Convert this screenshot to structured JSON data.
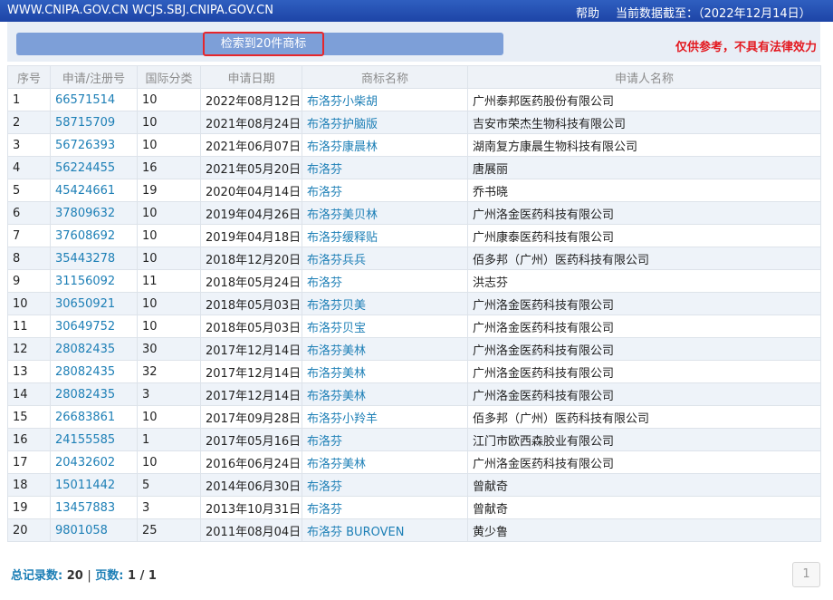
{
  "header": {
    "site": "WWW.CNIPA.GOV.CN WCJS.SBJ.CNIPA.GOV.CN",
    "help": "帮助",
    "data_as_of": "当前数据截至：（2022年12月14日）"
  },
  "search": {
    "result_label": "检索到20件商标",
    "disclaimer": "仅供参考，不具有法律效力"
  },
  "columns": [
    "序号",
    "申请/注册号",
    "国际分类",
    "申请日期",
    "商标名称",
    "申请人名称"
  ],
  "rows": [
    {
      "no": "1",
      "reg": "66571514",
      "cls": "10",
      "date": "2022年08月12日",
      "mark": "布洛芬小柴胡",
      "applicant": "广州泰邦医药股份有限公司"
    },
    {
      "no": "2",
      "reg": "58715709",
      "cls": "10",
      "date": "2021年08月24日",
      "mark": "布洛芬护脑版",
      "applicant": "吉安市荣杰生物科技有限公司"
    },
    {
      "no": "3",
      "reg": "56726393",
      "cls": "10",
      "date": "2021年06月07日",
      "mark": "布洛芬康晨林",
      "applicant": "湖南复方康晨生物科技有限公司"
    },
    {
      "no": "4",
      "reg": "56224455",
      "cls": "16",
      "date": "2021年05月20日",
      "mark": "布洛芬",
      "applicant": "唐展丽"
    },
    {
      "no": "5",
      "reg": "45424661",
      "cls": "19",
      "date": "2020年04月14日",
      "mark": "布洛芬",
      "applicant": "乔书晓"
    },
    {
      "no": "6",
      "reg": "37809632",
      "cls": "10",
      "date": "2019年04月26日",
      "mark": "布洛芬美贝林",
      "applicant": "广州洛金医药科技有限公司"
    },
    {
      "no": "7",
      "reg": "37608692",
      "cls": "10",
      "date": "2019年04月18日",
      "mark": "布洛芬缓释贴",
      "applicant": "广州康泰医药科技有限公司"
    },
    {
      "no": "8",
      "reg": "35443278",
      "cls": "10",
      "date": "2018年12月20日",
      "mark": "布洛芬兵兵",
      "applicant": "佰多邦（广州）医药科技有限公司"
    },
    {
      "no": "9",
      "reg": "31156092",
      "cls": "11",
      "date": "2018年05月24日",
      "mark": "布洛芬",
      "applicant": "洪志芬"
    },
    {
      "no": "10",
      "reg": "30650921",
      "cls": "10",
      "date": "2018年05月03日",
      "mark": "布洛芬贝美",
      "applicant": "广州洛金医药科技有限公司"
    },
    {
      "no": "11",
      "reg": "30649752",
      "cls": "10",
      "date": "2018年05月03日",
      "mark": "布洛芬贝宝",
      "applicant": "广州洛金医药科技有限公司"
    },
    {
      "no": "12",
      "reg": "28082435",
      "cls": "30",
      "date": "2017年12月14日",
      "mark": "布洛芬美林",
      "applicant": "广州洛金医药科技有限公司"
    },
    {
      "no": "13",
      "reg": "28082435",
      "cls": "32",
      "date": "2017年12月14日",
      "mark": "布洛芬美林",
      "applicant": "广州洛金医药科技有限公司"
    },
    {
      "no": "14",
      "reg": "28082435",
      "cls": "3",
      "date": "2017年12月14日",
      "mark": "布洛芬美林",
      "applicant": "广州洛金医药科技有限公司"
    },
    {
      "no": "15",
      "reg": "26683861",
      "cls": "10",
      "date": "2017年09月28日",
      "mark": "布洛芬小羚羊",
      "applicant": "佰多邦（广州）医药科技有限公司"
    },
    {
      "no": "16",
      "reg": "24155585",
      "cls": "1",
      "date": "2017年05月16日",
      "mark": "布洛芬",
      "applicant": "江门市欧西森胶业有限公司"
    },
    {
      "no": "17",
      "reg": "20432602",
      "cls": "10",
      "date": "2016年06月24日",
      "mark": "布洛芬美林",
      "applicant": "广州洛金医药科技有限公司"
    },
    {
      "no": "18",
      "reg": "15011442",
      "cls": "5",
      "date": "2014年06月30日",
      "mark": "布洛芬",
      "applicant": "曾献奇"
    },
    {
      "no": "19",
      "reg": "13457883",
      "cls": "3",
      "date": "2013年10月31日",
      "mark": "布洛芬",
      "applicant": "曾献奇"
    },
    {
      "no": "20",
      "reg": "9801058",
      "cls": "25",
      "date": "2011年08月04日",
      "mark": "布洛芬 BUROVEN",
      "applicant": "黄少鲁"
    }
  ],
  "footer": {
    "total_label": "总记录数:",
    "total_value": "20",
    "separator": "|",
    "pages_label": "页数:",
    "pages_value": "1 / 1",
    "page_button": "1"
  },
  "colors": {
    "topbar": "#1d44a6",
    "link": "#1d7fb6",
    "highlight_border": "#e6262b",
    "disclaimer": "#e3181f",
    "stripe": "#eef3f9"
  }
}
